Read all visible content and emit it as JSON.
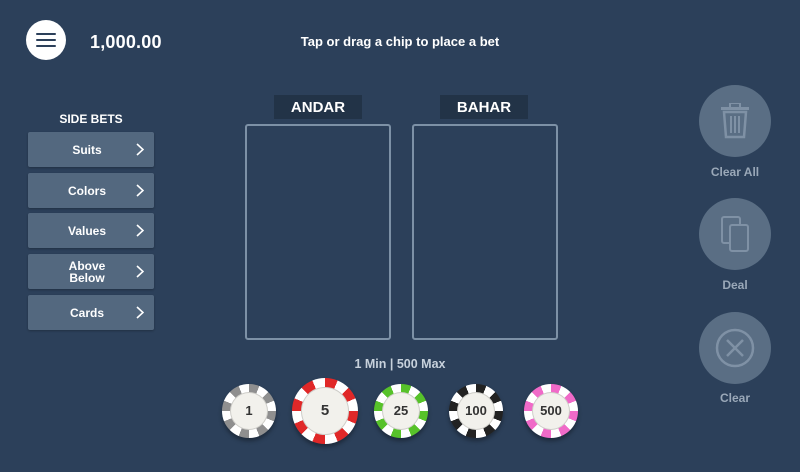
{
  "header": {
    "balance": "1,000.00",
    "hint": "Tap or drag a chip to place a bet",
    "menu_icon": "hamburger-icon"
  },
  "side_bets": {
    "title": "SIDE BETS",
    "items": [
      {
        "label": "Suits"
      },
      {
        "label": "Colors"
      },
      {
        "label": "Values"
      },
      {
        "label": "Above\nBelow"
      },
      {
        "label": "Cards"
      }
    ]
  },
  "zones": {
    "andar": "ANDAR",
    "bahar": "BAHAR"
  },
  "limits": "1 Min | 500 Max",
  "chips": [
    {
      "value": "1",
      "color": "#8f8f8f"
    },
    {
      "value": "5",
      "color": "#e02828"
    },
    {
      "value": "25",
      "color": "#57c22a"
    },
    {
      "value": "100",
      "color": "#222222"
    },
    {
      "value": "500",
      "color": "#f06ac8"
    }
  ],
  "actions": {
    "clear_all": "Clear All",
    "deal": "Deal",
    "clear": "Clear"
  },
  "colors": {
    "background": "#2c405a",
    "panel": "#53687f",
    "zone_title_bg": "#223347",
    "action_btn": "#5a6e84"
  }
}
